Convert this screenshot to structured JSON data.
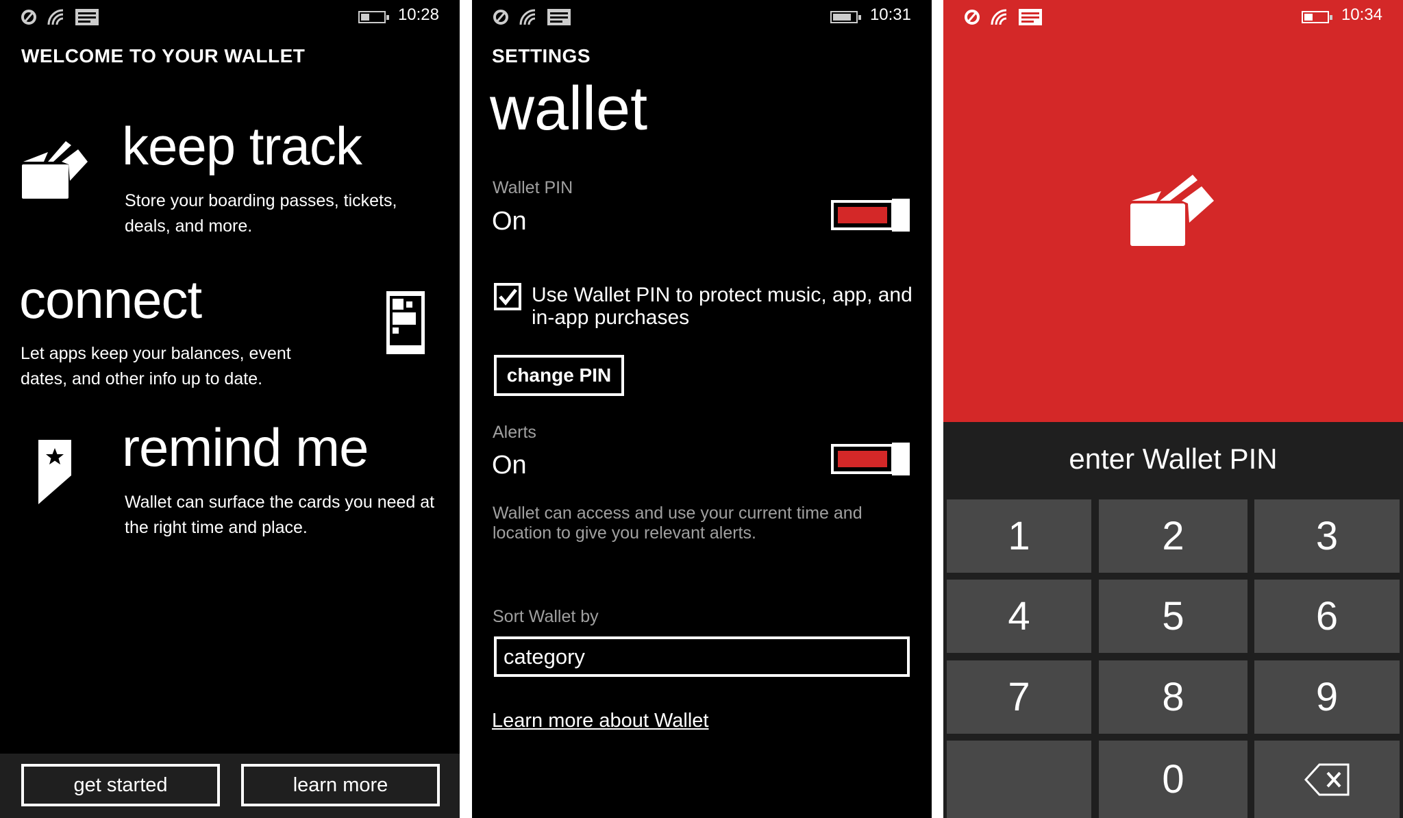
{
  "colors": {
    "accent": "#d42828",
    "panel_bg": "#000000",
    "keypad_bg": "#1f1f1f",
    "key_bg": "#484848"
  },
  "status_icons": [
    "signal-strength-icon",
    "wifi-icon",
    "message-icon",
    "battery-icon"
  ],
  "welcome": {
    "time": "10:28",
    "title": "WELCOME TO YOUR WALLET",
    "sections": [
      {
        "heading": "keep track",
        "text": "Store your boarding passes, tickets, deals, and more.",
        "icon": "wallet-cards-icon"
      },
      {
        "heading": "connect",
        "text": "Let apps keep your balances, event dates, and other info up to date.",
        "icon": "phone-tiles-icon"
      },
      {
        "heading": "remind me",
        "text": "Wallet can surface the cards you need at the right time and place.",
        "icon": "star-tag-icon"
      }
    ],
    "buttons": {
      "get_started": "get started",
      "learn_more": "learn more"
    }
  },
  "settings": {
    "time": "10:31",
    "section": "SETTINGS",
    "title": "wallet",
    "wallet_pin": {
      "label": "Wallet PIN",
      "value": "On",
      "enabled": true
    },
    "protect_purchases": {
      "label": "Use Wallet PIN to protect music, app, and in-app purchases",
      "checked": true
    },
    "change_pin": "change PIN",
    "alerts": {
      "label": "Alerts",
      "value": "On",
      "enabled": true,
      "description": "Wallet can access and use your current time and location to give you relevant alerts."
    },
    "sort": {
      "label": "Sort Wallet by",
      "value": "category"
    },
    "learn_more_link": "Learn more about Wallet"
  },
  "pin": {
    "time": "10:34",
    "prompt": "enter Wallet PIN",
    "keys": [
      "1",
      "2",
      "3",
      "4",
      "5",
      "6",
      "7",
      "8",
      "9",
      "",
      "0",
      "backspace"
    ]
  }
}
